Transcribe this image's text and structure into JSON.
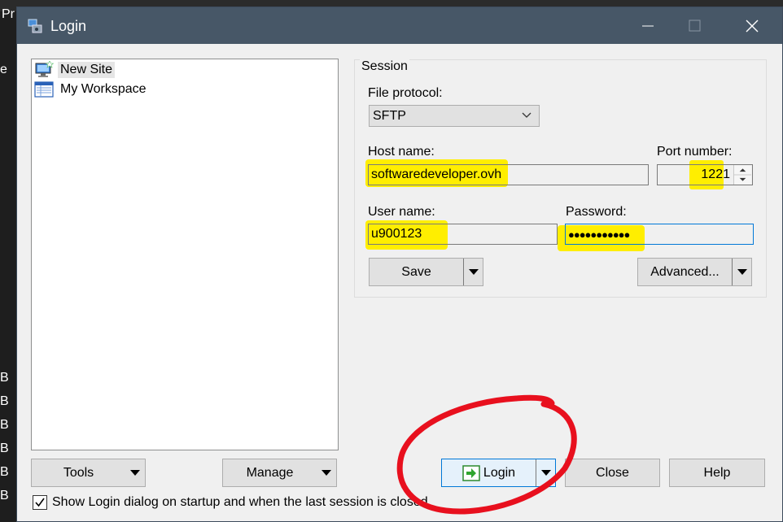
{
  "background": {
    "top_left": "Pr",
    "edge_letter": "e",
    "side_marks": [
      "B",
      "B",
      "B",
      "B",
      "B",
      "B"
    ]
  },
  "window": {
    "title": "Login",
    "titlebar_color": "#475767"
  },
  "sites": [
    {
      "label": "New Site",
      "icon": "computer-new-site-icon",
      "selected": true
    },
    {
      "label": "My Workspace",
      "icon": "workspace-icon",
      "selected": false
    }
  ],
  "session": {
    "legend": "Session",
    "protocol_label": "File protocol:",
    "protocol_value": "SFTP",
    "host_label": "Host name:",
    "host_value": "softwaredeveloper.ovh",
    "port_label": "Port number:",
    "port_value": "1221",
    "user_label": "User name:",
    "user_value": "u900123",
    "password_label": "Password:",
    "password_value": "●●●●●●●●●●●",
    "save_label": "Save",
    "advanced_label": "Advanced..."
  },
  "buttons": {
    "tools": "Tools",
    "manage": "Manage",
    "login": "Login",
    "close": "Close",
    "help": "Help"
  },
  "startup_checkbox": {
    "label": "Show Login dialog on startup and when the last session is closed",
    "checked": true
  },
  "colors": {
    "highlight": "#ffee00",
    "annotation": "#e8101e",
    "focus": "#0078d7"
  }
}
